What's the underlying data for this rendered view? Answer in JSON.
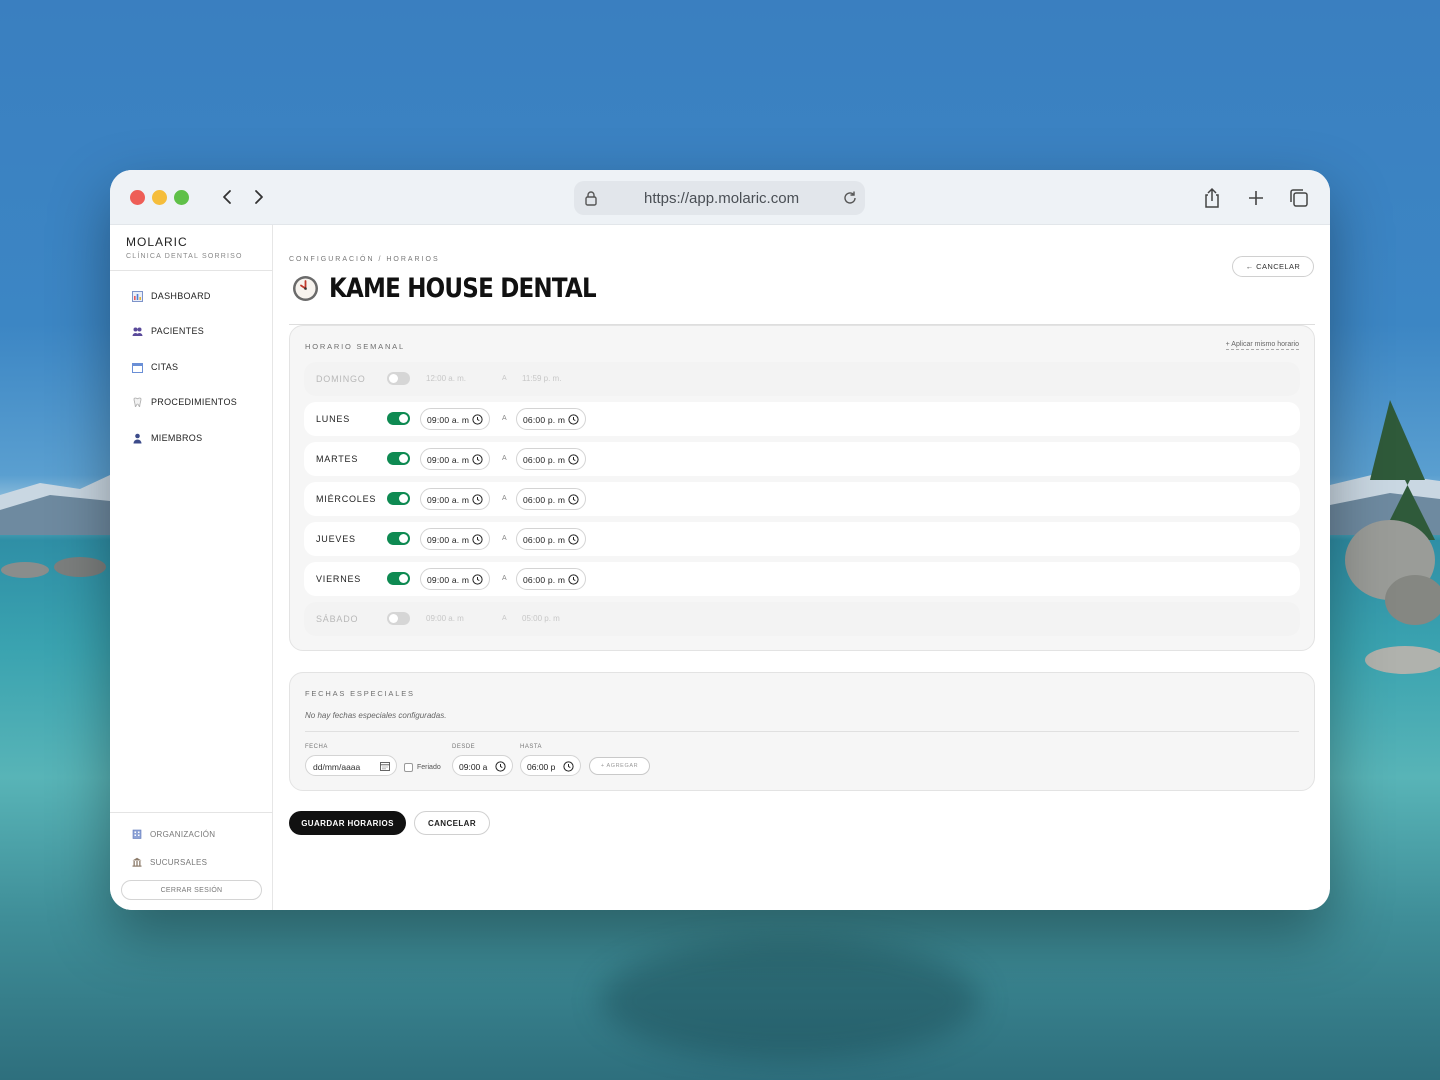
{
  "browser": {
    "url": "https://app.molaric.com"
  },
  "sidebar": {
    "brand": "MOLARIC",
    "clinic": "CLÍNICA DENTAL SORRISO",
    "items": [
      {
        "label": "DASHBOARD",
        "icon": "chart-icon"
      },
      {
        "label": "PACIENTES",
        "icon": "users-icon"
      },
      {
        "label": "CITAS",
        "icon": "calendar-icon"
      },
      {
        "label": "PROCEDIMIENTOS",
        "icon": "tooth-icon"
      },
      {
        "label": "MIEMBROS",
        "icon": "user-icon"
      }
    ],
    "bottom_items": [
      {
        "label": "ORGANIZACIÓN",
        "icon": "building-icon"
      },
      {
        "label": "SUCURSALES",
        "icon": "bank-icon"
      }
    ],
    "logout": "CERRAR SESIÓN"
  },
  "header": {
    "breadcrumb": "CONFIGURACIÓN / HORARIOS",
    "title": "KAME HOUSE DENTAL",
    "cancel": "← CANCELAR"
  },
  "weekly": {
    "title": "HORARIO SEMANAL",
    "apply_all": "+ Aplicar mismo horario",
    "separator": "A",
    "days": [
      {
        "name": "DOMINGO",
        "enabled": false,
        "start": "12:00 a. m.",
        "end": "11:59 p. m."
      },
      {
        "name": "LUNES",
        "enabled": true,
        "start": "09:00 a. m",
        "end": "06:00 p. m"
      },
      {
        "name": "MARTES",
        "enabled": true,
        "start": "09:00 a. m",
        "end": "06:00 p. m"
      },
      {
        "name": "MIÉRCOLES",
        "enabled": true,
        "start": "09:00 a. m",
        "end": "06:00 p. m"
      },
      {
        "name": "JUEVES",
        "enabled": true,
        "start": "09:00 a. m",
        "end": "06:00 p. m"
      },
      {
        "name": "VIERNES",
        "enabled": true,
        "start": "09:00 a. m",
        "end": "06:00 p. m"
      },
      {
        "name": "SÁBADO",
        "enabled": false,
        "start": "09:00 a. m",
        "end": "05:00 p. m"
      }
    ]
  },
  "special": {
    "title": "FECHAS ESPECIALES",
    "empty": "No hay fechas especiales configuradas.",
    "date_label": "FECHA",
    "date_placeholder": "dd/mm/aaaa",
    "holiday_label": "Feriado",
    "from_label": "DESDE",
    "from_value": "09:00 a",
    "to_label": "HASTA",
    "to_value": "06:00 p",
    "add": "+ AGREGAR"
  },
  "actions": {
    "save": "GUARDAR HORARIOS",
    "cancel": "CANCELAR"
  },
  "colors": {
    "toggle_on": "#0e8a52",
    "toggle_off": "#d6d6d6",
    "primary_button": "#111111"
  }
}
